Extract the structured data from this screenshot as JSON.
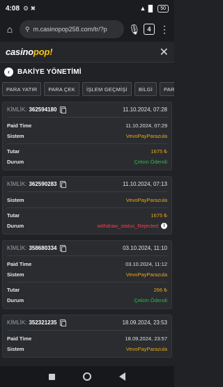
{
  "status_bar": {
    "time": "4:08",
    "left_icons": "⚙ ✖",
    "signal": "▲▐▌",
    "battery": "50"
  },
  "browser": {
    "url": "m.casinopop258.com/tr/?p",
    "tabs_count": "4"
  },
  "app": {
    "logo_prefix": "casino",
    "logo_accent": "pop!",
    "logo_suffix": ""
  },
  "section": {
    "title": "BAKİYE YÖNETİMİ"
  },
  "tabs": [
    {
      "label": "PARA YATIR"
    },
    {
      "label": "PARA ÇEK"
    },
    {
      "label": "İŞLEM GEÇMİŞİ"
    },
    {
      "label": "BİLGİ"
    },
    {
      "label": "PARA ÇEK"
    }
  ],
  "cards": [
    {
      "kimlik_label": "KİMLİK:",
      "id": "362594180",
      "date": "11.10.2024, 07:28",
      "paid_time_label": "Paid Time",
      "paid_time": "11.10.2024, 07:29",
      "sistem_label": "Sistem",
      "sistem": "VevoPayParazula",
      "tutar_label": "Tutar",
      "tutar": "1675 ₺",
      "durum_label": "Durum",
      "durum": "Çekim Ödendi"
    },
    {
      "kimlik_label": "KİMLİK:",
      "id": "362590283",
      "date": "11.10.2024, 07:13",
      "sistem_label": "Sistem",
      "sistem": "VevoPayParazula",
      "tutar_label": "Tutar",
      "tutar": "1675 ₺",
      "durum_label": "Durum",
      "durum": "withdraw_status_Rejected"
    },
    {
      "kimlik_label": "KİMLİK:",
      "id": "358680334",
      "date": "03.10.2024, 11:10",
      "paid_time_label": "Paid Time",
      "paid_time": "03.10.2024, 11:12",
      "sistem_label": "Sistem",
      "sistem": "VevoPayParazula",
      "tutar_label": "Tutar",
      "tutar": "266 ₺",
      "durum_label": "Durum",
      "durum": "Çekim Ödendi"
    },
    {
      "kimlik_label": "KİMLİK:",
      "id": "352321235",
      "date": "18.09.2024, 23:53",
      "paid_time_label": "Paid Time",
      "paid_time": "18.09.2024, 23:57",
      "sistem_label": "Sistem",
      "sistem": "VevoPayParazula"
    }
  ],
  "colors": {
    "gold": "#e8a71c",
    "green": "#2fb94a",
    "red": "#ff3b46",
    "bg": "#202226"
  }
}
